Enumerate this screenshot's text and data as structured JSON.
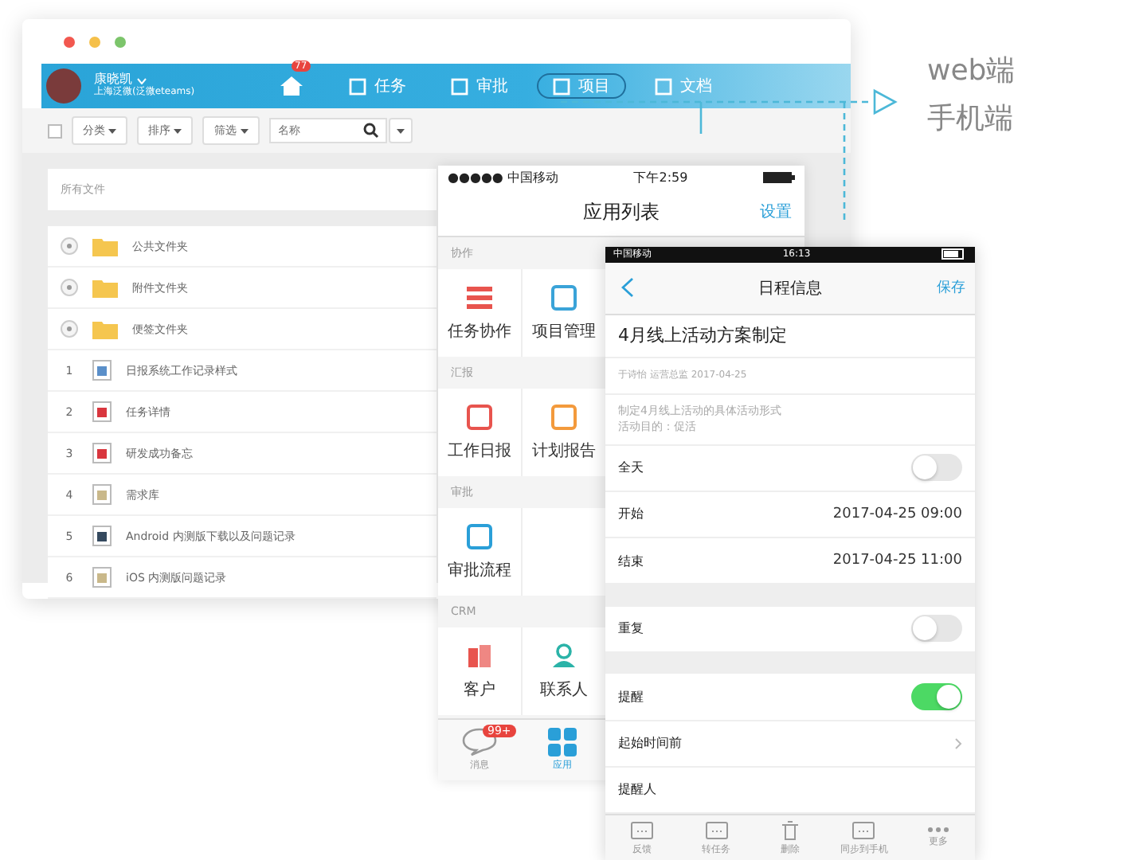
{
  "web_window": {
    "user": {
      "name": "康晓凯",
      "company": "上海泛微(泛微eteams)"
    },
    "nav": [
      {
        "kind": "home",
        "badge": "77",
        "selected": false
      },
      {
        "kind": "tasks",
        "label": "任务",
        "selected": false
      },
      {
        "kind": "approval",
        "label": "审批",
        "selected": false
      },
      {
        "kind": "project",
        "label": "项目",
        "selected": true
      },
      {
        "kind": "docs",
        "label": "文档",
        "selected": false
      }
    ],
    "toolbar": {
      "select_all": {
        "checked": false
      },
      "filters": [
        "分类",
        "排序",
        "筛选"
      ],
      "search": {
        "placeholder": "名称"
      }
    },
    "breadcrumb": "所有文件",
    "files": [
      {
        "kind": "folder",
        "name": "公共文件夹"
      },
      {
        "kind": "folder",
        "name": "附件文件夹"
      },
      {
        "kind": "folder",
        "name": "便签文件夹"
      },
      {
        "kind": "doc",
        "number": "1",
        "name": "日报系统工作记录样式"
      },
      {
        "kind": "task",
        "number": "2",
        "name": "任务详情"
      },
      {
        "kind": "image",
        "number": "3",
        "name": "研发成功备忘"
      },
      {
        "kind": "text",
        "number": "4",
        "name": "需求库"
      },
      {
        "kind": "app",
        "number": "5",
        "name": "Android 内测版下载以及问题记录"
      },
      {
        "kind": "text",
        "number": "6",
        "name": "iOS 内测版问题记录"
      }
    ]
  },
  "labels": {
    "web": "web端",
    "mobile": "手机端"
  },
  "app_list_phone": {
    "status": {
      "carrier": "●●●●● 中国移动",
      "time": "下午2:59"
    },
    "title": "应用列表",
    "action": "设置",
    "sections": [
      {
        "name": "协作",
        "apps": [
          {
            "kind": "tasks",
            "label": "任务协作"
          },
          {
            "kind": "project",
            "label": "项目管理"
          }
        ]
      },
      {
        "name": "汇报",
        "apps": [
          {
            "kind": "daily",
            "label": "工作日报"
          },
          {
            "kind": "plan",
            "label": "计划报告"
          }
        ]
      },
      {
        "name": "审批",
        "apps": [
          {
            "kind": "approval",
            "label": "审批流程"
          }
        ]
      },
      {
        "name": "CRM",
        "apps": [
          {
            "kind": "customer",
            "label": "客户"
          },
          {
            "kind": "contact",
            "label": "联系人"
          }
        ]
      }
    ],
    "tabs": [
      {
        "kind": "messages",
        "label": "消息",
        "badge": "99+",
        "selected": false
      },
      {
        "kind": "apps",
        "label": "应用",
        "selected": true
      }
    ]
  },
  "schedule_phone": {
    "status": {
      "carrier": "中国移动",
      "time": "16:13"
    },
    "title": "日程信息",
    "action": "保存",
    "event_title": "4月线上活动方案制定",
    "meta": "于诗怡 运营总监  2017-04-25",
    "description": [
      "制定4月线上活动的具体活动形式",
      "活动目的：促活"
    ],
    "groups": [
      [
        {
          "kind": "toggle",
          "label": "全天",
          "on": false
        },
        {
          "kind": "value",
          "label": "开始",
          "value": "2017-04-25 09:00"
        },
        {
          "kind": "value",
          "label": "结束",
          "value": "2017-04-25 11:00"
        }
      ],
      [
        {
          "kind": "toggle",
          "label": "重复",
          "on": false
        }
      ],
      [
        {
          "kind": "toggle",
          "label": "提醒",
          "on": true
        },
        {
          "kind": "link",
          "label": "起始时间前"
        },
        {
          "kind": "plain",
          "label": "提醒人"
        }
      ]
    ],
    "actions": [
      {
        "kind": "feedback",
        "label": "反馈"
      },
      {
        "kind": "convert",
        "label": "转任务"
      },
      {
        "kind": "delete",
        "label": "删除"
      },
      {
        "kind": "sync",
        "label": "同步到手机"
      },
      {
        "kind": "more",
        "label": "更多"
      }
    ]
  }
}
